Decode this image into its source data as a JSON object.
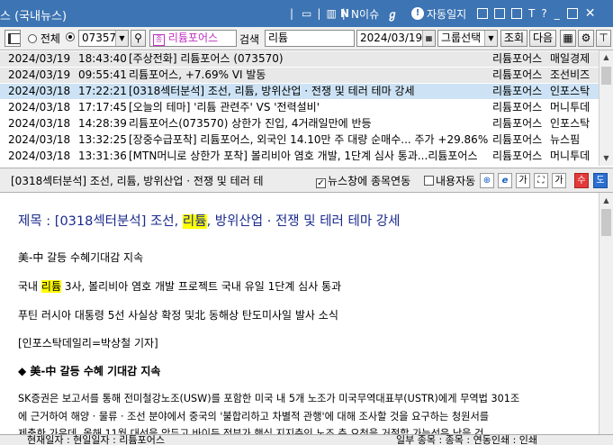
{
  "window": {
    "title": "스 (국내뉴스)",
    "title_buttons": [
      "N이슈",
      "자동일지"
    ]
  },
  "toolbar": {
    "radio_all": "전체",
    "stock_code": "073570",
    "stock_name": "리튬포어스",
    "search_label": "검색",
    "search_value": "리튬",
    "date": "2024/03/19",
    "group_select": "그룹선택",
    "query_button": "조회",
    "next_button": "다음"
  },
  "news_list": [
    {
      "date": "2024/03/19",
      "time": "18:43:40",
      "title": "[주상전화] 리튬포어스 (073570)",
      "company": "리튬포어스",
      "source": "매일경제"
    },
    {
      "date": "2024/03/19",
      "time": "09:55:41",
      "title": "리튬포어스, +7.69% VI 발동",
      "company": "리튬포어스",
      "source": "조선비즈"
    },
    {
      "date": "2024/03/18",
      "time": "17:22:21",
      "title": "[0318섹터분석] 조선, 리튬, 방위산업 · 전쟁 및 테러 테마 강세",
      "company": "리튬포어스",
      "source": "인포스탁"
    },
    {
      "date": "2024/03/18",
      "time": "17:17:45",
      "title": "[오늘의 테마] '리튬 관련주' VS '전력설비'",
      "company": "리튬포어스",
      "source": "머니투데"
    },
    {
      "date": "2024/03/18",
      "time": "14:28:39",
      "title": "리튬포어스(073570) 상한가 진입, 4거래일만에 반등",
      "company": "리튬포어스",
      "source": "인포스탁"
    },
    {
      "date": "2024/03/18",
      "time": "13:32:25",
      "title": "[장중수급포착] 리튬포어스, 외국인 14.10만 주 대량 순매수... 주가 +29.86%",
      "company": "리튬포어스",
      "source": "뉴스핌"
    },
    {
      "date": "2024/03/18",
      "time": "13:31:36",
      "title": "[MTN머니로 상한가 포착] 볼리비아 염호 개발, 1단계 심사 통과...리튬포어스",
      "company": "리튬포어스",
      "source": "머니투데"
    }
  ],
  "article_bar": {
    "title": "[0318섹터분석] 조선, 리튬, 방위산업 · 전쟁 및 테러 테",
    "check1": "뉴스창에 종목연동",
    "check2": "내용자동"
  },
  "article": {
    "title_prefix": "제목 : [0318섹터분석] 조선, ",
    "title_hl": "리튬",
    "title_suffix": ", 방위산업 · 전쟁 및 테러 테마 강세",
    "line1": "美-中 갈등 수혜기대감 지속",
    "line2_prefix": "국내 ",
    "line2_hl": "리튬",
    "line2_suffix": " 3사, 볼리비아 염호 개발 프로젝트 국내 유일 1단계 심사 통과",
    "line3": "푸틴 러시아 대통령 5선 사실상 확정 및北 동해상 탄도미사일 발사 소식",
    "line4": "[인포스탁데일리=박상철 기자]",
    "section": "◆ 美-中 갈등 수혜 기대감 지속",
    "body1": "SK증권은 보고서를 통해 전미철강노조(USW)를 포함한 미국 내 5개 노조가 미국무역대표부(USTR)에게 무역법 301조",
    "body2": "에 근거하여 해양 · 물류 · 조선 분야에서 중국의 '불합리하고 차별적 관행'에 대해 조사할 것을 요구하는 청원서를",
    "body3": "제출한 가운데, 올해 11월 대선을 앞두고 바이든 정부가 핵심 지지층인 노조 측 요청을 거절할 가능성은 낮을 것"
  },
  "bottom": {
    "left": "현재일자 : 현일일자 : 리튬포어스",
    "right": "일부 종목 : 종목 : 연동인쇄 : 인쇄"
  }
}
